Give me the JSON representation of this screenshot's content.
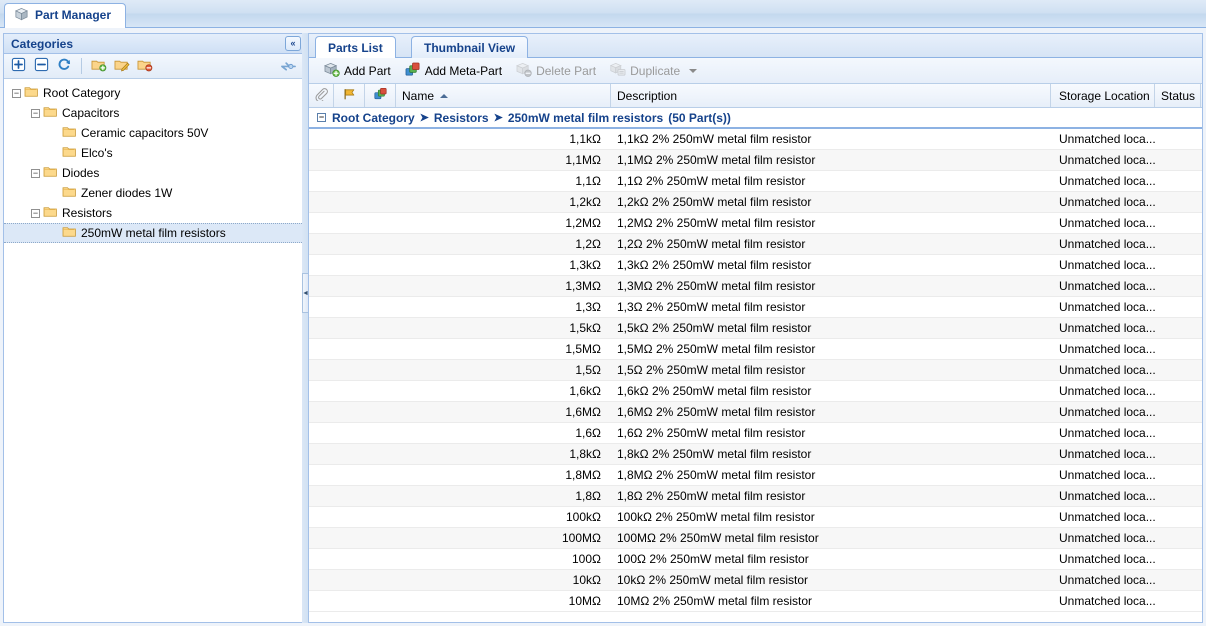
{
  "window": {
    "tab_label": "Part Manager",
    "tab_icon": "box-icon"
  },
  "sidebar": {
    "header": "Categories",
    "collapse_label": "«",
    "toolbar": [
      {
        "name": "expand-all-button",
        "icon": "plus-box-icon"
      },
      {
        "name": "collapse-all-button",
        "icon": "minus-box-icon"
      },
      {
        "name": "refresh-button",
        "icon": "refresh-icon"
      },
      {
        "name": "add-category-button",
        "icon": "folder-add-icon"
      },
      {
        "name": "edit-category-button",
        "icon": "folder-edit-icon"
      },
      {
        "name": "delete-category-button",
        "icon": "folder-delete-icon"
      }
    ],
    "pin_icon": "pin-icon",
    "tree": [
      {
        "label": "Root Category",
        "depth": 0,
        "expander": "minus",
        "selected": false
      },
      {
        "label": "Capacitors",
        "depth": 1,
        "expander": "minus",
        "selected": false
      },
      {
        "label": "Ceramic capacitors 50V",
        "depth": 2,
        "expander": "none",
        "selected": false
      },
      {
        "label": "Elco's",
        "depth": 2,
        "expander": "none",
        "selected": false
      },
      {
        "label": "Diodes",
        "depth": 1,
        "expander": "minus",
        "selected": false
      },
      {
        "label": "Zener diodes 1W",
        "depth": 2,
        "expander": "none",
        "selected": false
      },
      {
        "label": "Resistors",
        "depth": 1,
        "expander": "minus",
        "selected": false
      },
      {
        "label": "250mW metal film resistors",
        "depth": 2,
        "expander": "none",
        "selected": true
      }
    ]
  },
  "main": {
    "tabs": [
      {
        "label": "Parts List",
        "active": true
      },
      {
        "label": "Thumbnail View",
        "active": false
      }
    ],
    "toolbar": [
      {
        "label": "Add Part",
        "icon": "add-part-icon",
        "disabled": false,
        "dropdown": false
      },
      {
        "label": "Add Meta-Part",
        "icon": "add-meta-part-icon",
        "disabled": false,
        "dropdown": false
      },
      {
        "label": "Delete Part",
        "icon": "delete-part-icon",
        "disabled": true,
        "dropdown": false
      },
      {
        "label": "Duplicate",
        "icon": "duplicate-icon",
        "disabled": true,
        "dropdown": true
      }
    ],
    "columns": {
      "attachment_icon": "paperclip-icon",
      "flag_icon": "flag-icon",
      "meta_icon": "meta-part-icon",
      "name": "Name",
      "name_sort": "ascending",
      "description": "Description",
      "storage_location": "Storage Location",
      "status": "Status"
    },
    "group": {
      "path": [
        "Root Category",
        "Resistors",
        "250mW metal film resistors"
      ],
      "separator": "➤",
      "count_label": "(50 Part(s))",
      "expander": "minus"
    },
    "rows": [
      {
        "name": "1,1kΩ",
        "description": "1,1kΩ 2% 250mW metal film resistor",
        "location": "Unmatched loca...",
        "status": ""
      },
      {
        "name": "1,1MΩ",
        "description": "1,1MΩ 2% 250mW metal film resistor",
        "location": "Unmatched loca...",
        "status": ""
      },
      {
        "name": "1,1Ω",
        "description": "1,1Ω 2% 250mW metal film resistor",
        "location": "Unmatched loca...",
        "status": ""
      },
      {
        "name": "1,2kΩ",
        "description": "1,2kΩ 2% 250mW metal film resistor",
        "location": "Unmatched loca...",
        "status": ""
      },
      {
        "name": "1,2MΩ",
        "description": "1,2MΩ 2% 250mW metal film resistor",
        "location": "Unmatched loca...",
        "status": ""
      },
      {
        "name": "1,2Ω",
        "description": "1,2Ω 2% 250mW metal film resistor",
        "location": "Unmatched loca...",
        "status": ""
      },
      {
        "name": "1,3kΩ",
        "description": "1,3kΩ 2% 250mW metal film resistor",
        "location": "Unmatched loca...",
        "status": ""
      },
      {
        "name": "1,3MΩ",
        "description": "1,3MΩ 2% 250mW metal film resistor",
        "location": "Unmatched loca...",
        "status": ""
      },
      {
        "name": "1,3Ω",
        "description": "1,3Ω 2% 250mW metal film resistor",
        "location": "Unmatched loca...",
        "status": ""
      },
      {
        "name": "1,5kΩ",
        "description": "1,5kΩ 2% 250mW metal film resistor",
        "location": "Unmatched loca...",
        "status": ""
      },
      {
        "name": "1,5MΩ",
        "description": "1,5MΩ 2% 250mW metal film resistor",
        "location": "Unmatched loca...",
        "status": ""
      },
      {
        "name": "1,5Ω",
        "description": "1,5Ω 2% 250mW metal film resistor",
        "location": "Unmatched loca...",
        "status": ""
      },
      {
        "name": "1,6kΩ",
        "description": "1,6kΩ 2% 250mW metal film resistor",
        "location": "Unmatched loca...",
        "status": ""
      },
      {
        "name": "1,6MΩ",
        "description": "1,6MΩ 2% 250mW metal film resistor",
        "location": "Unmatched loca...",
        "status": ""
      },
      {
        "name": "1,6Ω",
        "description": "1,6Ω 2% 250mW metal film resistor",
        "location": "Unmatched loca...",
        "status": ""
      },
      {
        "name": "1,8kΩ",
        "description": "1,8kΩ 2% 250mW metal film resistor",
        "location": "Unmatched loca...",
        "status": ""
      },
      {
        "name": "1,8MΩ",
        "description": "1,8MΩ 2% 250mW metal film resistor",
        "location": "Unmatched loca...",
        "status": ""
      },
      {
        "name": "1,8Ω",
        "description": "1,8Ω 2% 250mW metal film resistor",
        "location": "Unmatched loca...",
        "status": ""
      },
      {
        "name": "100kΩ",
        "description": "100kΩ 2% 250mW metal film resistor",
        "location": "Unmatched loca...",
        "status": ""
      },
      {
        "name": "100MΩ",
        "description": "100MΩ 2% 250mW metal film resistor",
        "location": "Unmatched loca...",
        "status": ""
      },
      {
        "name": "100Ω",
        "description": "100Ω 2% 250mW metal film resistor",
        "location": "Unmatched loca...",
        "status": ""
      },
      {
        "name": "10kΩ",
        "description": "10kΩ 2% 250mW metal film resistor",
        "location": "Unmatched loca...",
        "status": ""
      },
      {
        "name": "10MΩ",
        "description": "10MΩ 2% 250mW metal film resistor",
        "location": "Unmatched loca...",
        "status": ""
      }
    ]
  },
  "splitter": {
    "arrow": "◄"
  }
}
